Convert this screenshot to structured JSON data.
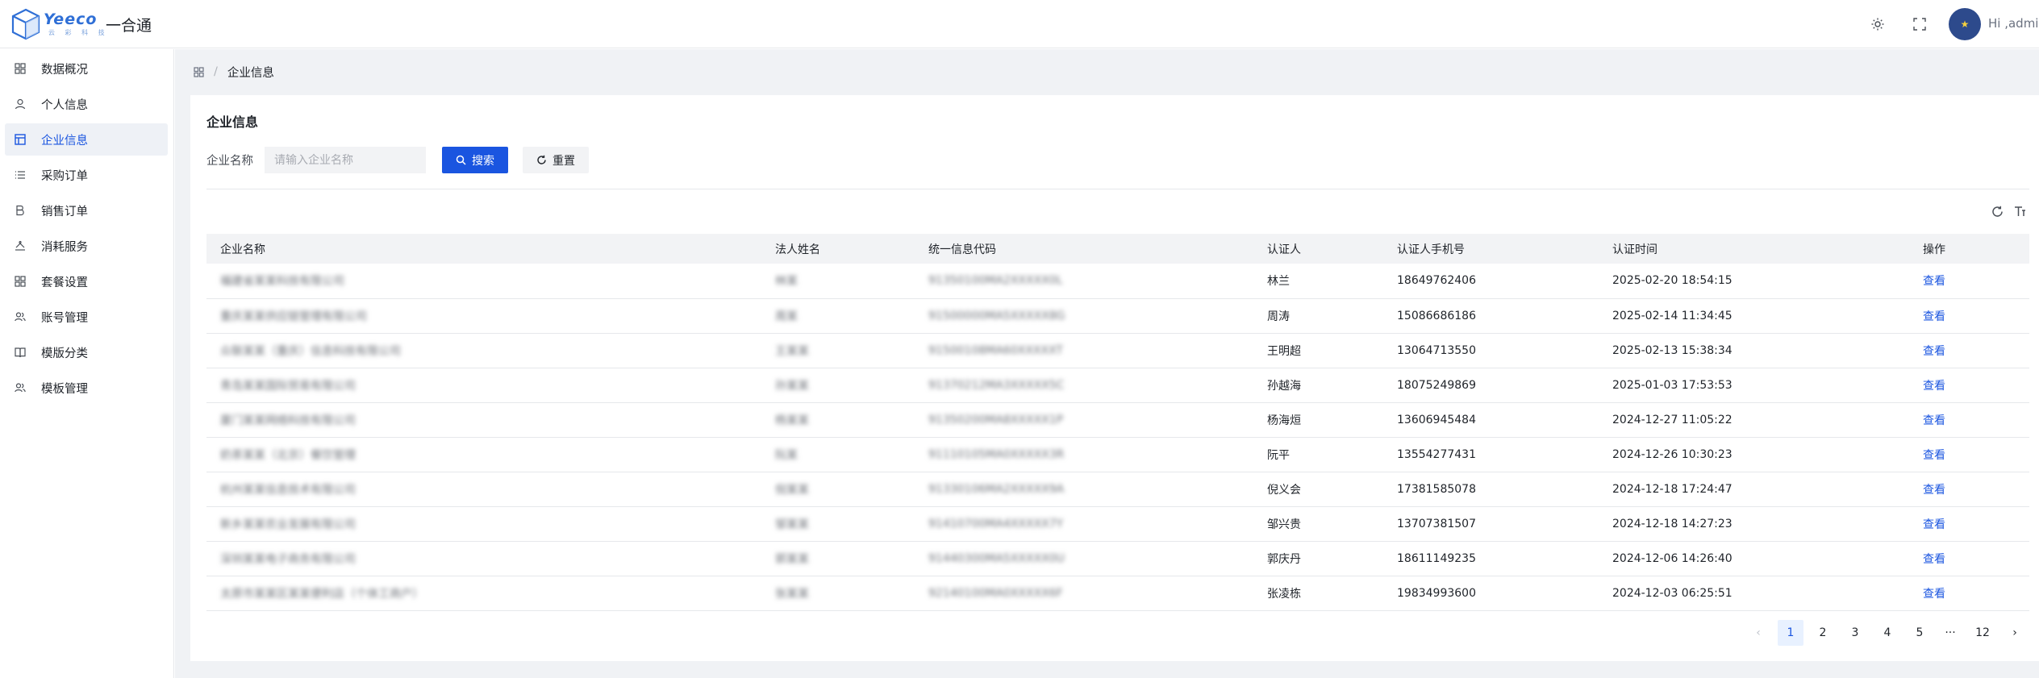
{
  "header": {
    "logo_text": "Yeeco",
    "logo_sub": "云 彩 科 技",
    "app_name": "一合通",
    "user_greeting": "Hi ,admin"
  },
  "sidebar": {
    "items": [
      {
        "label": "数据概况",
        "icon": "dashboard-grid-icon"
      },
      {
        "label": "个人信息",
        "icon": "user-icon"
      },
      {
        "label": "企业信息",
        "icon": "layout-icon"
      },
      {
        "label": "采购订单",
        "icon": "list-icon"
      },
      {
        "label": "销售订单",
        "icon": "bold-b-icon"
      },
      {
        "label": "消耗服务",
        "icon": "service-icon"
      },
      {
        "label": "套餐设置",
        "icon": "grid-icon"
      },
      {
        "label": "账号管理",
        "icon": "users-icon"
      },
      {
        "label": "模版分类",
        "icon": "book-icon"
      },
      {
        "label": "模板管理",
        "icon": "users-icon"
      }
    ],
    "active_index": 2
  },
  "breadcrumb": {
    "home_icon": "grid-home-icon",
    "separator": "/",
    "current": "企业信息"
  },
  "page": {
    "title": "企业信息",
    "search_label": "企业名称",
    "search_placeholder": "请输入企业名称",
    "search_button": "搜索",
    "reset_button": "重置"
  },
  "table": {
    "columns": [
      "企业名称",
      "法人姓名",
      "统一信息代码",
      "认证人",
      "认证人手机号",
      "认证时间",
      "操作"
    ],
    "rows": [
      {
        "company": "福建省某某科技有限公司",
        "legal": "林某",
        "code": "91350100MA2XXXXX0L",
        "certifier": "林兰",
        "phone": "18649762406",
        "time": "2025-02-20 18:54:15",
        "action": "查看"
      },
      {
        "company": "重庆某某供应链管理有限公司",
        "legal": "周某",
        "code": "91500000MA5XXXXX8G",
        "certifier": "周涛",
        "phone": "15086686186",
        "time": "2025-02-14 11:34:45",
        "action": "查看"
      },
      {
        "company": "众联某某（重庆）信息科技有限公司",
        "legal": "王某某",
        "code": "91500108MA60XXXXXT",
        "certifier": "王明超",
        "phone": "13064713550",
        "time": "2025-02-13 15:38:34",
        "action": "查看"
      },
      {
        "company": "青岛某某国际贸易有限公司",
        "legal": "孙某某",
        "code": "91370212MA3XXXXX5C",
        "certifier": "孙越海",
        "phone": "18075249869",
        "time": "2025-01-03 17:53:53",
        "action": "查看"
      },
      {
        "company": "厦门某某网络科技有限公司",
        "legal": "杨某某",
        "code": "91350200MA8XXXXX1P",
        "certifier": "杨海烜",
        "phone": "13606945484",
        "time": "2024-12-27 11:05:22",
        "action": "查看"
      },
      {
        "company": "奶茶某某（北京）餐饮管理",
        "legal": "阮某",
        "code": "91110105MA0XXXXX3R",
        "certifier": "阮平",
        "phone": "13554277431",
        "time": "2024-12-26 10:30:23",
        "action": "查看"
      },
      {
        "company": "杭州某某信息技术有限公司",
        "legal": "倪某某",
        "code": "91330106MA2XXXXX9A",
        "certifier": "倪义会",
        "phone": "17381585078",
        "time": "2024-12-18 17:24:47",
        "action": "查看"
      },
      {
        "company": "新乡某某农业发展有限公司",
        "legal": "邹某某",
        "code": "91410700MA4XXXXX7Y",
        "certifier": "邹兴贵",
        "phone": "13707381507",
        "time": "2024-12-18 14:27:23",
        "action": "查看"
      },
      {
        "company": "深圳某某电子商务有限公司",
        "legal": "郭某某",
        "code": "91440300MA5XXXXX0U",
        "certifier": "郭庆丹",
        "phone": "18611149235",
        "time": "2024-12-06 14:26:40",
        "action": "查看"
      },
      {
        "company": "太原市某某区某某便利店（个体工商户）",
        "legal": "张某某",
        "code": "92140100MA0XXXXX6F",
        "certifier": "张凌栋",
        "phone": "19834993600",
        "time": "2024-12-03 06:25:51",
        "action": "查看"
      }
    ]
  },
  "pagination": {
    "prev": "‹",
    "pages": [
      "1",
      "2",
      "3",
      "4",
      "5"
    ],
    "ellipsis": "···",
    "last": "12",
    "next": "›",
    "current": "1"
  }
}
